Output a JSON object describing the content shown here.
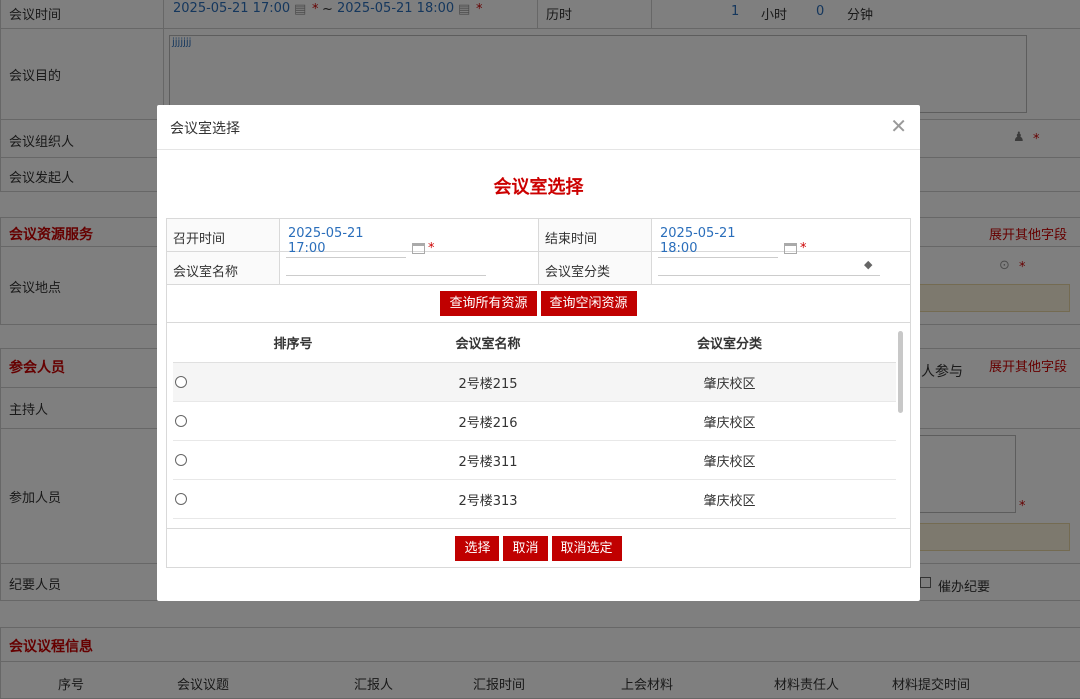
{
  "bg": {
    "meeting_time_label": "会议时间",
    "start": "2025-05-21 17:00",
    "tilde": "~",
    "end": "2025-05-21 18:00",
    "duration_label": "历时",
    "hours": "1",
    "hours_unit": "小时",
    "minutes": "0",
    "minutes_unit": "分钟",
    "purpose_label": "会议目的",
    "purpose_value": "jjjjjjj",
    "organizer_label": "会议组织人",
    "initiator_label": "会议发起人",
    "resource_section": "会议资源服务",
    "expand_more": "展开其他字段",
    "location_label": "会议地点",
    "attendees_section": "参会人员",
    "participate_text": "人参与",
    "expand_more2": "展开其他字段",
    "host_label": "主持人",
    "participants_label": "参加人员",
    "minutes_taker_label": "纪要人员",
    "urge_minutes": "催办纪要",
    "agenda_section": "会议议程信息",
    "agenda_cols": [
      "序号",
      "会议议题",
      "汇报人",
      "汇报时间",
      "上会材料",
      "材料责任人",
      "材料提交时间"
    ]
  },
  "modal": {
    "title": "会议室选择",
    "heading": "会议室选择",
    "start_label": "召开时间",
    "start_value": "2025-05-21 17:00",
    "end_label": "结束时间",
    "end_value": "2025-05-21 18:00",
    "room_name_label": "会议室名称",
    "room_category_label": "会议室分类",
    "query_all": "查询所有资源",
    "query_free": "查询空闲资源",
    "columns": [
      "排序号",
      "会议室名称",
      "会议室分类"
    ],
    "rows": [
      {
        "name": "2号楼215",
        "category": "肇庆校区"
      },
      {
        "name": "2号楼216",
        "category": "肇庆校区"
      },
      {
        "name": "2号楼311",
        "category": "肇庆校区"
      },
      {
        "name": "2号楼313",
        "category": "肇庆校区"
      }
    ],
    "select_btn": "选择",
    "cancel_btn": "取消",
    "clear_btn": "取消选定"
  }
}
